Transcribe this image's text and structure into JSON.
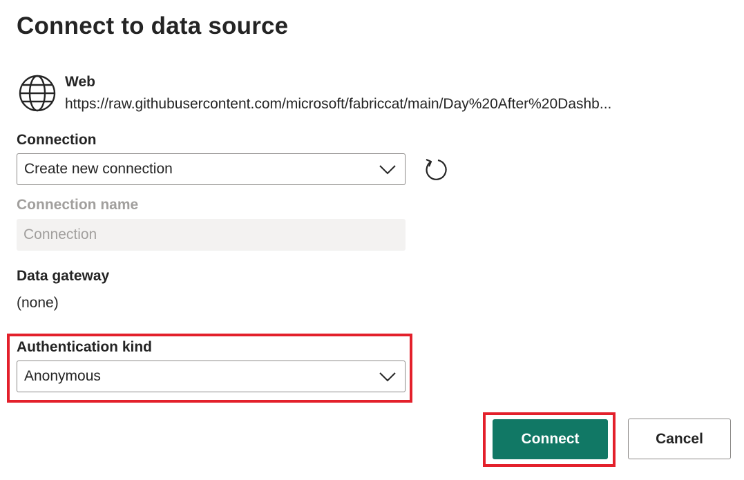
{
  "dialog": {
    "title": "Connect to data source"
  },
  "source": {
    "icon": "globe-icon",
    "name": "Web",
    "url": "https://raw.githubusercontent.com/microsoft/fabriccat/main/Day%20After%20Dashb..."
  },
  "connection": {
    "label": "Connection",
    "selected": "Create new connection",
    "refresh_icon": "refresh-icon"
  },
  "connection_name": {
    "label": "Connection name",
    "placeholder": "Connection"
  },
  "gateway": {
    "label": "Data gateway",
    "value": "(none)"
  },
  "authentication": {
    "label": "Authentication kind",
    "selected": "Anonymous"
  },
  "buttons": {
    "connect": "Connect",
    "cancel": "Cancel"
  },
  "colors": {
    "primary": "#117865",
    "highlight": "#e3202b"
  }
}
